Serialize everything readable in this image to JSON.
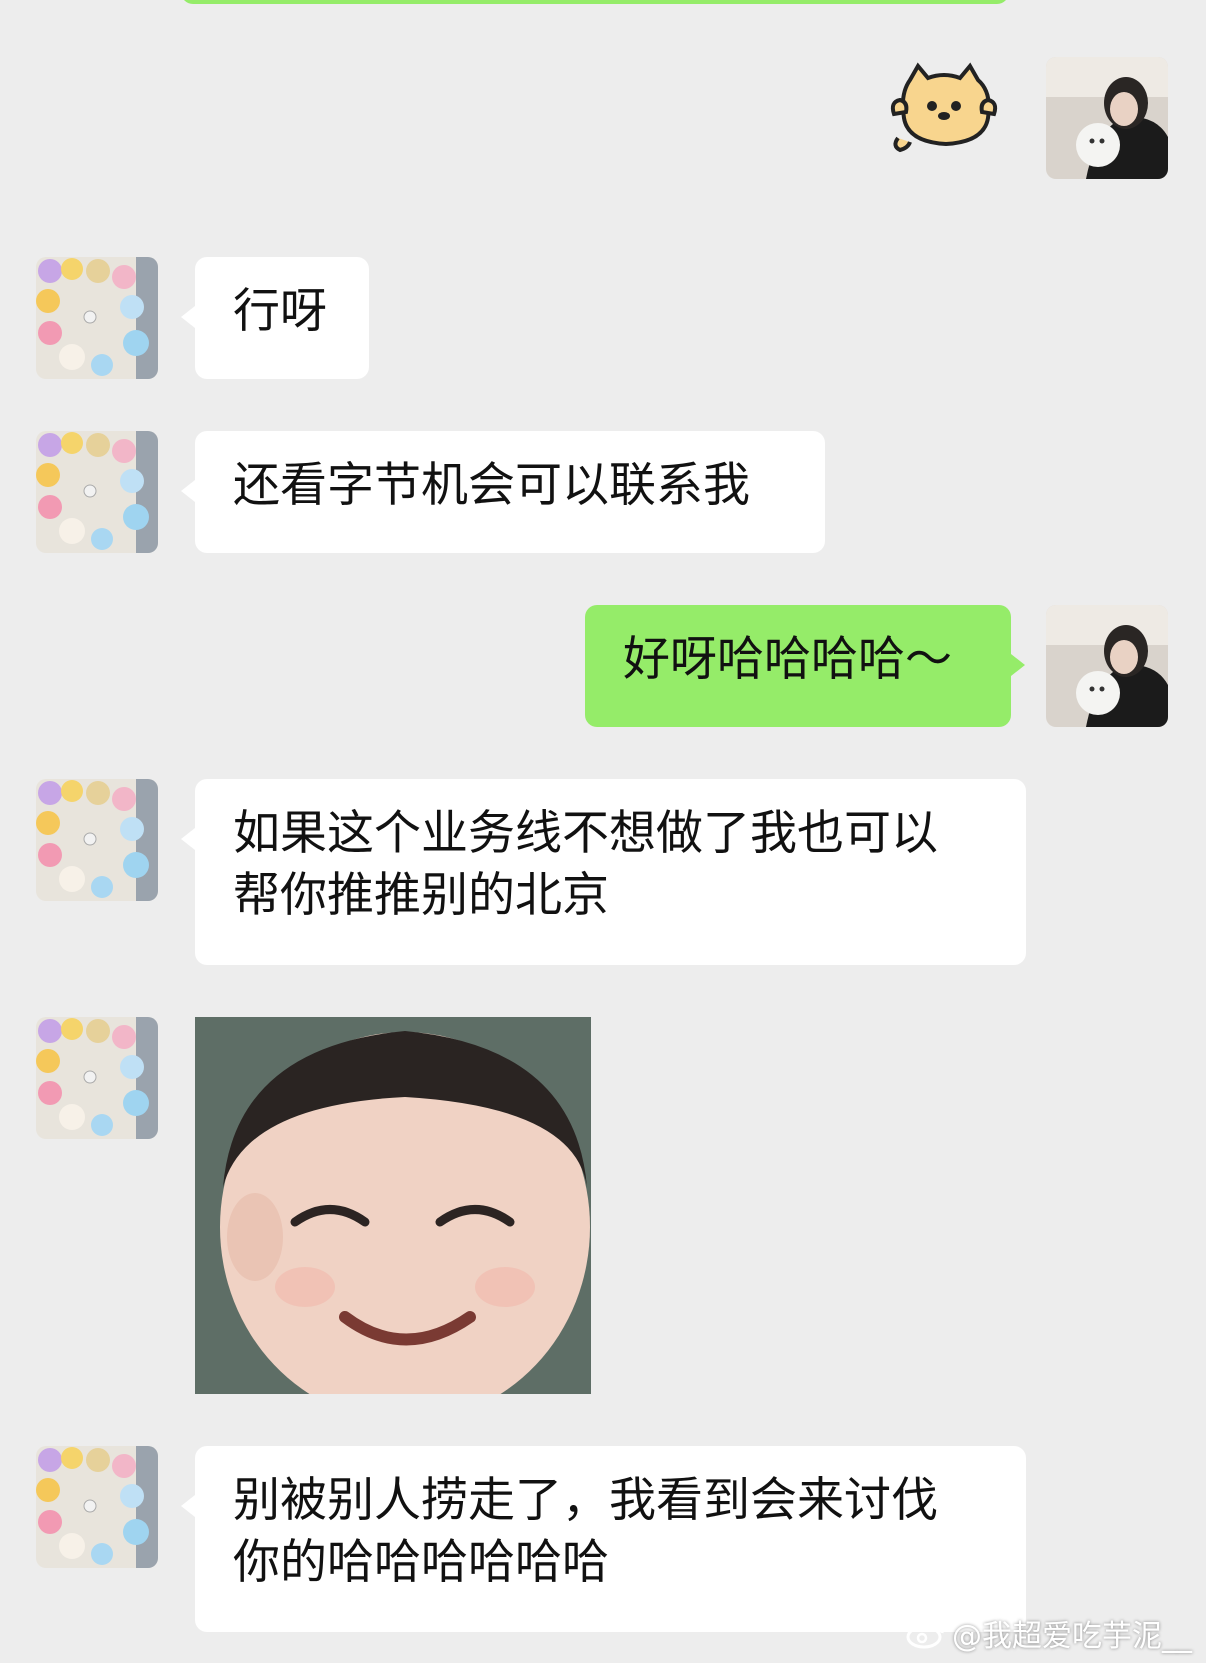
{
  "messages": {
    "m1": "行呀",
    "m2": "还看字节机会可以联系我",
    "m3": "好呀哈哈哈哈～",
    "m4_line1": "如果这个业务线不想做了我也可以",
    "m4_line2": "帮你推推别的北京",
    "m6_line1": "别被别人捞走了，我看到会来讨伐",
    "m6_line2": "你的哈哈哈哈哈哈"
  },
  "watermark": {
    "text": "@我超爱吃芋泥__"
  },
  "colors": {
    "background": "#ededed",
    "incoming_bubble": "#ffffff",
    "outgoing_bubble": "#95ec69"
  },
  "icons": {
    "sticker": "cat-sticker-icon",
    "weibo": "weibo-icon"
  }
}
